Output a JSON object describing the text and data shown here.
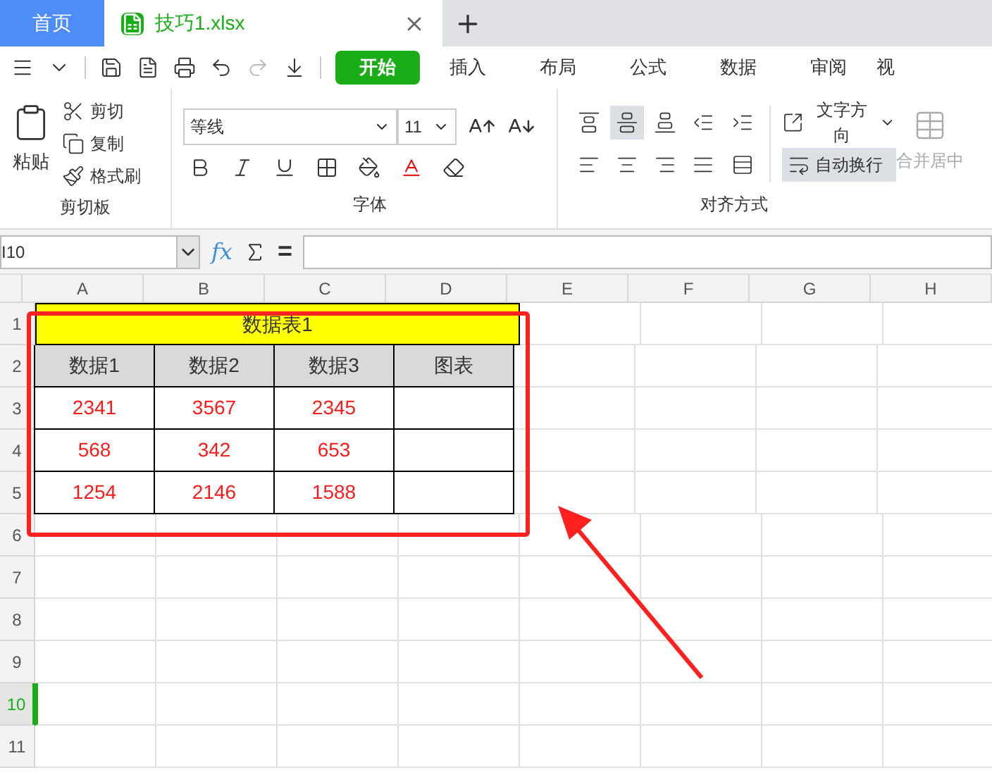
{
  "tabs": [
    {
      "label": "首页",
      "kind": "home",
      "selected": false
    },
    {
      "label": "技巧1.xlsx",
      "kind": "file",
      "selected": true
    }
  ],
  "menu_tabs": [
    {
      "label": "开始",
      "selected": true
    },
    {
      "label": "插入",
      "selected": false
    },
    {
      "label": "布局",
      "selected": false
    },
    {
      "label": "公式",
      "selected": false
    },
    {
      "label": "数据",
      "selected": false
    },
    {
      "label": "审阅",
      "selected": false
    },
    {
      "label": "视",
      "selected": false
    }
  ],
  "ribbon": {
    "clipboard": {
      "paste": "粘贴",
      "items": [
        "剪切",
        "复制",
        "格式刷"
      ],
      "label": "剪切板"
    },
    "font": {
      "font_name": "等线",
      "font_size": "11",
      "label": "字体"
    },
    "alignment": {
      "align_buttons": [
        {
          "selected": false
        },
        {
          "selected": true
        },
        {
          "selected": false
        },
        {
          "selected": false
        },
        {
          "selected": false
        },
        {
          "selected": false
        },
        {
          "selected": false
        },
        {
          "selected": false
        },
        {
          "selected": false
        },
        {
          "selected": false
        }
      ],
      "text_direction": "文字方向",
      "wrap": {
        "label": "自动换行",
        "on": true
      },
      "label": "对齐方式"
    },
    "merge": {
      "label": "合并居中",
      "disabled": true
    }
  },
  "formula_bar": {
    "name_box": "I10",
    "function_symbol": "fx",
    "equals": "="
  },
  "sheet": {
    "columns": [
      "A",
      "B",
      "C",
      "D",
      "E",
      "F",
      "G",
      "H"
    ],
    "row_numbers": [
      {
        "label": "1",
        "selected": false
      },
      {
        "label": "2",
        "selected": false
      },
      {
        "label": "3",
        "selected": false
      },
      {
        "label": "4",
        "selected": false
      },
      {
        "label": "5",
        "selected": false
      },
      {
        "label": "6",
        "selected": false
      },
      {
        "label": "7",
        "selected": false
      },
      {
        "label": "8",
        "selected": false
      },
      {
        "label": "9",
        "selected": false
      },
      {
        "label": "10",
        "selected": true
      },
      {
        "label": "11",
        "selected": false
      }
    ],
    "title": "数据表1",
    "headers": [
      "数据1",
      "数据2",
      "数据3",
      "图表"
    ],
    "rows": [
      [
        "2341",
        "3567",
        "2345",
        ""
      ],
      [
        "568",
        "342",
        "653",
        ""
      ],
      [
        "1254",
        "2146",
        "1588",
        ""
      ]
    ]
  }
}
